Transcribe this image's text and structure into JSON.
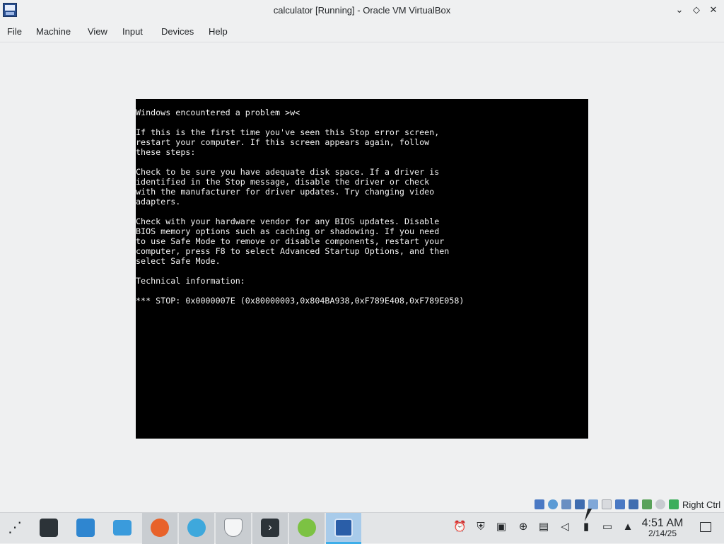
{
  "window": {
    "title": "calculator [Running] - Oracle VM VirtualBox",
    "app_icon": "virtualbox-icon",
    "controls": [
      "minimize-icon",
      "maximize-icon",
      "close-icon"
    ]
  },
  "menubar": {
    "items": [
      "File",
      "Machine",
      "View",
      "Input",
      "Devices",
      "Help"
    ]
  },
  "vm_screen": {
    "lines": [
      "Windows encountered a problem >w<",
      "",
      "If this is the first time you've seen this Stop error screen,",
      "restart your computer. If this screen appears again, follow",
      "these steps:",
      "",
      "Check to be sure you have adequate disk space. If a driver is",
      "identified in the Stop message, disable the driver or check",
      "with the manufacturer for driver updates. Try changing video",
      "adapters.",
      "",
      "Check with your hardware vendor for any BIOS updates. Disable",
      "BIOS memory options such as caching or shadowing. If you need",
      "to use Safe Mode to remove or disable components, restart your",
      "computer, press F8 to select Advanced Startup Options, and then",
      "select Safe Mode.",
      "",
      "Technical information:",
      "",
      "*** STOP: 0x0000007E (0x80000003,0x804BA938,0xF789E408,0xF789E058)"
    ]
  },
  "statusbar": {
    "icons": [
      "hard-disk-icon",
      "optical-drive-icon",
      "audio-icon",
      "network-icon",
      "usb-icon",
      "shared-folders-icon",
      "display-icon",
      "recording-icon",
      "cpu-icon",
      "mouse-integration-icon",
      "keyboard-icon"
    ],
    "host_key": "Right Ctrl"
  },
  "taskbar": {
    "apps": [
      {
        "name": "app-launcher",
        "icon": "launcher-icon"
      },
      {
        "name": "system-settings",
        "icon": "settings-icon"
      },
      {
        "name": "discover",
        "icon": "store-icon"
      },
      {
        "name": "file-manager",
        "icon": "folder-icon"
      },
      {
        "name": "firefox",
        "icon": "firefox-icon"
      },
      {
        "name": "globe-app",
        "icon": "globe-icon"
      },
      {
        "name": "shield-app",
        "icon": "shield-icon"
      },
      {
        "name": "terminal",
        "icon": "terminal-icon"
      },
      {
        "name": "updater",
        "icon": "update-arrow-icon"
      },
      {
        "name": "virtualbox",
        "icon": "virtualbox-icon"
      }
    ],
    "tray_icons": [
      "alarm-icon",
      "security-shield-icon",
      "clipboard-icon",
      "update-icon",
      "printer-icon",
      "mute-icon",
      "usb-device-icon",
      "network-wired-icon",
      "expand-tray-icon"
    ],
    "clock": {
      "time": "4:51 AM",
      "date": "2/14/25"
    }
  },
  "colors": {
    "bsod_background": "#000000",
    "bsod_text": "#f2f2f2",
    "window_background": "#eff0f1",
    "taskbar_focus": "#3daee9"
  }
}
